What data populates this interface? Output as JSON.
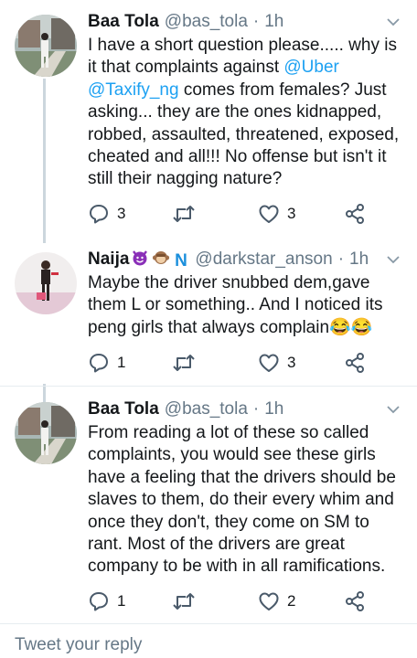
{
  "tweets": [
    {
      "name": "Baa Tola",
      "handle": "@bas_tola",
      "sep": "·",
      "time": "1h",
      "lines": [
        [
          "I have a short question please..... why is"
        ],
        [
          "it that complaints against ",
          {
            "m": "@Uber"
          }
        ],
        [
          {
            "m": "@Taxify_ng"
          },
          " comes from females? Just"
        ],
        [
          "asking... they are the ones kidnapped,"
        ],
        [
          "robbed, assaulted, threatened, exposed,"
        ],
        [
          "cheated and all!!! No offense but isn't it"
        ],
        [
          "still their nagging nature?"
        ]
      ],
      "reply_count": "3",
      "retweet_count": "",
      "like_count": "3"
    },
    {
      "name": "Naija",
      "name_emojis": [
        "smiling-devil",
        "monkey",
        "n-badge"
      ],
      "n_badge": "N",
      "handle": "@darkstar_anson",
      "sep": "·",
      "time": "1h",
      "lines": [
        [
          "Maybe the driver snubbed dem,gave"
        ],
        [
          "them L or something.. And I noticed its"
        ],
        [
          "peng girls that always complain😂😂"
        ]
      ],
      "reply_count": "1",
      "retweet_count": "",
      "like_count": "3"
    },
    {
      "name": "Baa Tola",
      "handle": "@bas_tola",
      "sep": "·",
      "time": "1h",
      "lines": [
        [
          "From reading a lot of these so called"
        ],
        [
          "complaints, you would see these girls"
        ],
        [
          "have a feeling that the drivers should be"
        ],
        [
          "slaves to them, do their every whim and"
        ],
        [
          "once they don't, they come on SM to"
        ],
        [
          "rant. Most of the drivers are great"
        ],
        [
          "company to be with in all ramifications."
        ]
      ],
      "reply_count": "1",
      "retweet_count": "",
      "like_count": "2"
    }
  ],
  "reply_bar": {
    "placeholder": "Tweet your reply"
  },
  "colors": {
    "mention": "#1da1f2",
    "secondary": "#657786",
    "icon": "#4a5a6a",
    "divider": "#e6ecf0"
  }
}
